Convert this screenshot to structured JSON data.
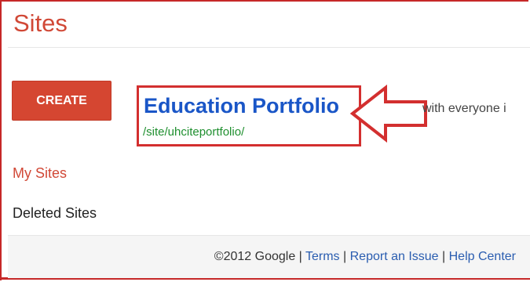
{
  "header": {
    "title": "Sites"
  },
  "actions": {
    "create_label": "CREATE"
  },
  "site": {
    "name": "Education Portfolio",
    "url": "/site/uhciteportfolio/",
    "sharing_text": "with everyone i"
  },
  "sidebar": {
    "my_sites": "My Sites",
    "deleted_sites": "Deleted Sites"
  },
  "footer": {
    "copyright": "©2012 Google",
    "separator": "|",
    "terms": "Terms",
    "report": "Report an Issue",
    "help": "Help Center"
  },
  "colors": {
    "brand_red": "#d14836",
    "button_red": "#d54631",
    "link_blue": "#2a5db0",
    "site_title_blue": "#1a56c7",
    "url_green": "#1f8f2f",
    "annotation_red": "#d32f2f"
  },
  "icons": {
    "callout": "arrow-pointer-icon"
  }
}
